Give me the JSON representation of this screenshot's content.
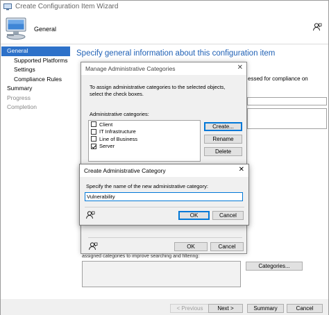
{
  "wizard": {
    "title": "Create Configuration Item Wizard",
    "banner_title": "General",
    "main_title": "Specify general information about this configuration item",
    "side_text": "essed for compliance on",
    "bg_text": "assigned categories to improve searching and filtering:",
    "categories_button": "Categories...",
    "nav": [
      {
        "label": "General",
        "state": "active"
      },
      {
        "label": "Supported Platforms",
        "state": "sub"
      },
      {
        "label": "Settings",
        "state": "sub"
      },
      {
        "label": "Compliance Rules",
        "state": "sub"
      },
      {
        "label": "Summary",
        "state": "normal"
      },
      {
        "label": "Progress",
        "state": "dim"
      },
      {
        "label": "Completion",
        "state": "dim"
      }
    ],
    "footer": {
      "previous": "< Previous",
      "next": "Next >",
      "summary": "Summary",
      "cancel": "Cancel"
    }
  },
  "manage_dialog": {
    "title": "Manage Administrative Categories",
    "instructions": "To assign administrative categories to the selected objects, select the check boxes.",
    "list_label": "Administrative categories:",
    "categories": [
      {
        "label": "Client",
        "checked": false
      },
      {
        "label": "IT Infrastructure",
        "checked": false
      },
      {
        "label": "Line of Business",
        "checked": false
      },
      {
        "label": "Server",
        "checked": true
      }
    ],
    "create_button": "Create...",
    "rename_button": "Rename",
    "delete_button": "Delete",
    "ok_button": "OK",
    "cancel_button": "Cancel"
  },
  "create_dialog": {
    "title": "Create Administrative Category",
    "prompt": "Specify the name of the new administrative category:",
    "value": "Vulnerability",
    "ok_button": "OK",
    "cancel_button": "Cancel"
  },
  "colors": {
    "accent": "#2d71c9",
    "heading": "#2061b5",
    "focus": "#0078d7"
  }
}
